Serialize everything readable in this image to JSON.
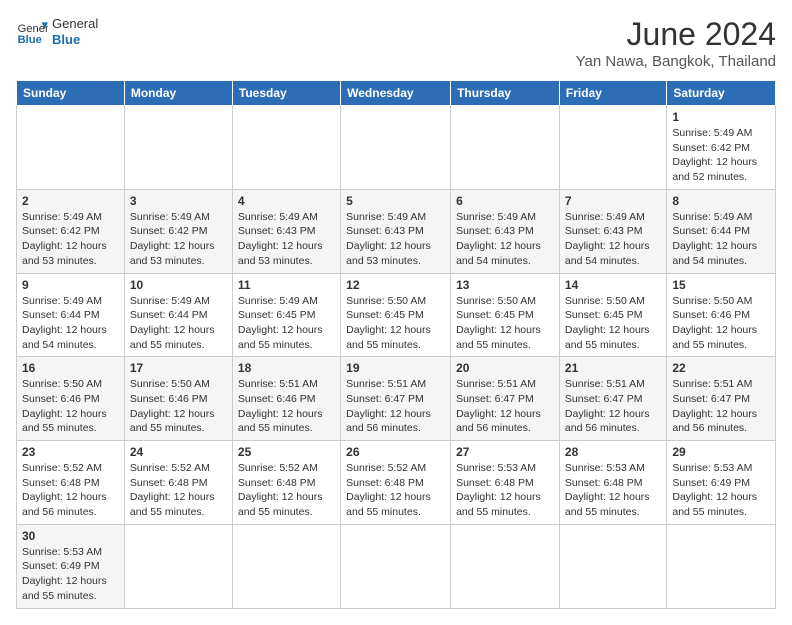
{
  "header": {
    "logo_general": "General",
    "logo_blue": "Blue",
    "month": "June 2024",
    "location": "Yan Nawa, Bangkok, Thailand"
  },
  "weekdays": [
    "Sunday",
    "Monday",
    "Tuesday",
    "Wednesday",
    "Thursday",
    "Friday",
    "Saturday"
  ],
  "weeks": [
    [
      {
        "day": "",
        "sunrise": "",
        "sunset": "",
        "daylight": ""
      },
      {
        "day": "",
        "sunrise": "",
        "sunset": "",
        "daylight": ""
      },
      {
        "day": "",
        "sunrise": "",
        "sunset": "",
        "daylight": ""
      },
      {
        "day": "",
        "sunrise": "",
        "sunset": "",
        "daylight": ""
      },
      {
        "day": "",
        "sunrise": "",
        "sunset": "",
        "daylight": ""
      },
      {
        "day": "",
        "sunrise": "",
        "sunset": "",
        "daylight": ""
      },
      {
        "day": "1",
        "sunrise": "Sunrise: 5:49 AM",
        "sunset": "Sunset: 6:42 PM",
        "daylight": "Daylight: 12 hours and 52 minutes."
      }
    ],
    [
      {
        "day": "2",
        "sunrise": "Sunrise: 5:49 AM",
        "sunset": "Sunset: 6:42 PM",
        "daylight": "Daylight: 12 hours and 53 minutes."
      },
      {
        "day": "3",
        "sunrise": "Sunrise: 5:49 AM",
        "sunset": "Sunset: 6:42 PM",
        "daylight": "Daylight: 12 hours and 53 minutes."
      },
      {
        "day": "4",
        "sunrise": "Sunrise: 5:49 AM",
        "sunset": "Sunset: 6:43 PM",
        "daylight": "Daylight: 12 hours and 53 minutes."
      },
      {
        "day": "5",
        "sunrise": "Sunrise: 5:49 AM",
        "sunset": "Sunset: 6:43 PM",
        "daylight": "Daylight: 12 hours and 53 minutes."
      },
      {
        "day": "6",
        "sunrise": "Sunrise: 5:49 AM",
        "sunset": "Sunset: 6:43 PM",
        "daylight": "Daylight: 12 hours and 54 minutes."
      },
      {
        "day": "7",
        "sunrise": "Sunrise: 5:49 AM",
        "sunset": "Sunset: 6:43 PM",
        "daylight": "Daylight: 12 hours and 54 minutes."
      },
      {
        "day": "8",
        "sunrise": "Sunrise: 5:49 AM",
        "sunset": "Sunset: 6:44 PM",
        "daylight": "Daylight: 12 hours and 54 minutes."
      }
    ],
    [
      {
        "day": "9",
        "sunrise": "Sunrise: 5:49 AM",
        "sunset": "Sunset: 6:44 PM",
        "daylight": "Daylight: 12 hours and 54 minutes."
      },
      {
        "day": "10",
        "sunrise": "Sunrise: 5:49 AM",
        "sunset": "Sunset: 6:44 PM",
        "daylight": "Daylight: 12 hours and 55 minutes."
      },
      {
        "day": "11",
        "sunrise": "Sunrise: 5:49 AM",
        "sunset": "Sunset: 6:45 PM",
        "daylight": "Daylight: 12 hours and 55 minutes."
      },
      {
        "day": "12",
        "sunrise": "Sunrise: 5:50 AM",
        "sunset": "Sunset: 6:45 PM",
        "daylight": "Daylight: 12 hours and 55 minutes."
      },
      {
        "day": "13",
        "sunrise": "Sunrise: 5:50 AM",
        "sunset": "Sunset: 6:45 PM",
        "daylight": "Daylight: 12 hours and 55 minutes."
      },
      {
        "day": "14",
        "sunrise": "Sunrise: 5:50 AM",
        "sunset": "Sunset: 6:45 PM",
        "daylight": "Daylight: 12 hours and 55 minutes."
      },
      {
        "day": "15",
        "sunrise": "Sunrise: 5:50 AM",
        "sunset": "Sunset: 6:46 PM",
        "daylight": "Daylight: 12 hours and 55 minutes."
      }
    ],
    [
      {
        "day": "16",
        "sunrise": "Sunrise: 5:50 AM",
        "sunset": "Sunset: 6:46 PM",
        "daylight": "Daylight: 12 hours and 55 minutes."
      },
      {
        "day": "17",
        "sunrise": "Sunrise: 5:50 AM",
        "sunset": "Sunset: 6:46 PM",
        "daylight": "Daylight: 12 hours and 55 minutes."
      },
      {
        "day": "18",
        "sunrise": "Sunrise: 5:51 AM",
        "sunset": "Sunset: 6:46 PM",
        "daylight": "Daylight: 12 hours and 55 minutes."
      },
      {
        "day": "19",
        "sunrise": "Sunrise: 5:51 AM",
        "sunset": "Sunset: 6:47 PM",
        "daylight": "Daylight: 12 hours and 56 minutes."
      },
      {
        "day": "20",
        "sunrise": "Sunrise: 5:51 AM",
        "sunset": "Sunset: 6:47 PM",
        "daylight": "Daylight: 12 hours and 56 minutes."
      },
      {
        "day": "21",
        "sunrise": "Sunrise: 5:51 AM",
        "sunset": "Sunset: 6:47 PM",
        "daylight": "Daylight: 12 hours and 56 minutes."
      },
      {
        "day": "22",
        "sunrise": "Sunrise: 5:51 AM",
        "sunset": "Sunset: 6:47 PM",
        "daylight": "Daylight: 12 hours and 56 minutes."
      }
    ],
    [
      {
        "day": "23",
        "sunrise": "Sunrise: 5:52 AM",
        "sunset": "Sunset: 6:48 PM",
        "daylight": "Daylight: 12 hours and 56 minutes."
      },
      {
        "day": "24",
        "sunrise": "Sunrise: 5:52 AM",
        "sunset": "Sunset: 6:48 PM",
        "daylight": "Daylight: 12 hours and 55 minutes."
      },
      {
        "day": "25",
        "sunrise": "Sunrise: 5:52 AM",
        "sunset": "Sunset: 6:48 PM",
        "daylight": "Daylight: 12 hours and 55 minutes."
      },
      {
        "day": "26",
        "sunrise": "Sunrise: 5:52 AM",
        "sunset": "Sunset: 6:48 PM",
        "daylight": "Daylight: 12 hours and 55 minutes."
      },
      {
        "day": "27",
        "sunrise": "Sunrise: 5:53 AM",
        "sunset": "Sunset: 6:48 PM",
        "daylight": "Daylight: 12 hours and 55 minutes."
      },
      {
        "day": "28",
        "sunrise": "Sunrise: 5:53 AM",
        "sunset": "Sunset: 6:48 PM",
        "daylight": "Daylight: 12 hours and 55 minutes."
      },
      {
        "day": "29",
        "sunrise": "Sunrise: 5:53 AM",
        "sunset": "Sunset: 6:49 PM",
        "daylight": "Daylight: 12 hours and 55 minutes."
      }
    ],
    [
      {
        "day": "30",
        "sunrise": "Sunrise: 5:53 AM",
        "sunset": "Sunset: 6:49 PM",
        "daylight": "Daylight: 12 hours and 55 minutes."
      },
      {
        "day": "",
        "sunrise": "",
        "sunset": "",
        "daylight": ""
      },
      {
        "day": "",
        "sunrise": "",
        "sunset": "",
        "daylight": ""
      },
      {
        "day": "",
        "sunrise": "",
        "sunset": "",
        "daylight": ""
      },
      {
        "day": "",
        "sunrise": "",
        "sunset": "",
        "daylight": ""
      },
      {
        "day": "",
        "sunrise": "",
        "sunset": "",
        "daylight": ""
      },
      {
        "day": "",
        "sunrise": "",
        "sunset": "",
        "daylight": ""
      }
    ]
  ]
}
